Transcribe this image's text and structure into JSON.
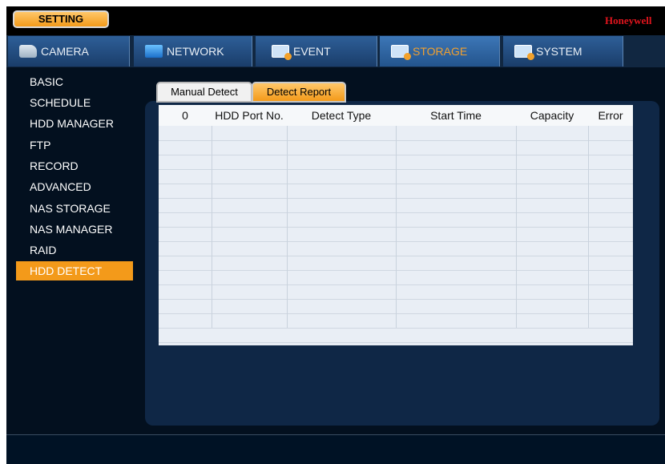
{
  "window": {
    "title_button": "SETTING",
    "brand": "Honeywell"
  },
  "tabs": [
    {
      "label": "CAMERA",
      "icon": "camera-icon",
      "active": false
    },
    {
      "label": "NETWORK",
      "icon": "network-icon",
      "active": false
    },
    {
      "label": "EVENT",
      "icon": "event-icon",
      "active": false
    },
    {
      "label": "STORAGE",
      "icon": "storage-icon",
      "active": true
    },
    {
      "label": "SYSTEM",
      "icon": "system-icon",
      "active": false
    }
  ],
  "sidebar": {
    "items": [
      {
        "label": "BASIC",
        "active": false
      },
      {
        "label": "SCHEDULE",
        "active": false
      },
      {
        "label": "HDD MANAGER",
        "active": false
      },
      {
        "label": "FTP",
        "active": false
      },
      {
        "label": "RECORD",
        "active": false
      },
      {
        "label": "ADVANCED",
        "active": false
      },
      {
        "label": "NAS STORAGE",
        "active": false
      },
      {
        "label": "NAS MANAGER",
        "active": false
      },
      {
        "label": "RAID",
        "active": false
      },
      {
        "label": "HDD DETECT",
        "active": true
      }
    ]
  },
  "subtabs": [
    {
      "label": "Manual Detect",
      "active": false
    },
    {
      "label": "Detect Report",
      "active": true
    }
  ],
  "table": {
    "columns": [
      "0",
      "HDD Port No.",
      "Detect Type",
      "Start Time",
      "Capacity",
      "Error"
    ],
    "rows": []
  },
  "colors": {
    "accent": "#f39a1a",
    "tab_blue": "#2e5f98",
    "background": "#03101f",
    "brand_red": "#e0141d"
  }
}
